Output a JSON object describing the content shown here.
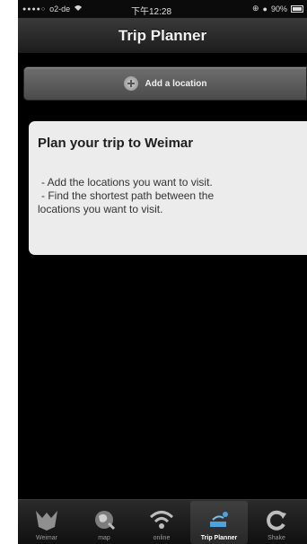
{
  "status_bar": {
    "carrier": "o2-de",
    "time": "下午12:28",
    "battery": "90%"
  },
  "nav": {
    "title": "Trip Planner"
  },
  "add_location_button": {
    "label": "Add a location",
    "icon": "plus-circle-icon"
  },
  "info_card": {
    "title": "Plan your trip to Weimar",
    "line1": "- Add the locations you want to visit.",
    "line2": "- Find the shortest path between the",
    "line3": "locations you want to visit."
  },
  "tab_bar": {
    "tabs": [
      {
        "label": "Weimar",
        "icon": "bauhaus-logo-icon"
      },
      {
        "label": "map",
        "icon": "globe-icon"
      },
      {
        "label": "online",
        "icon": "wifi-icon"
      },
      {
        "label": "Trip Planner",
        "icon": "trip-planner-icon"
      },
      {
        "label": "Shake",
        "icon": "refresh-icon"
      }
    ],
    "active_index": 3
  }
}
